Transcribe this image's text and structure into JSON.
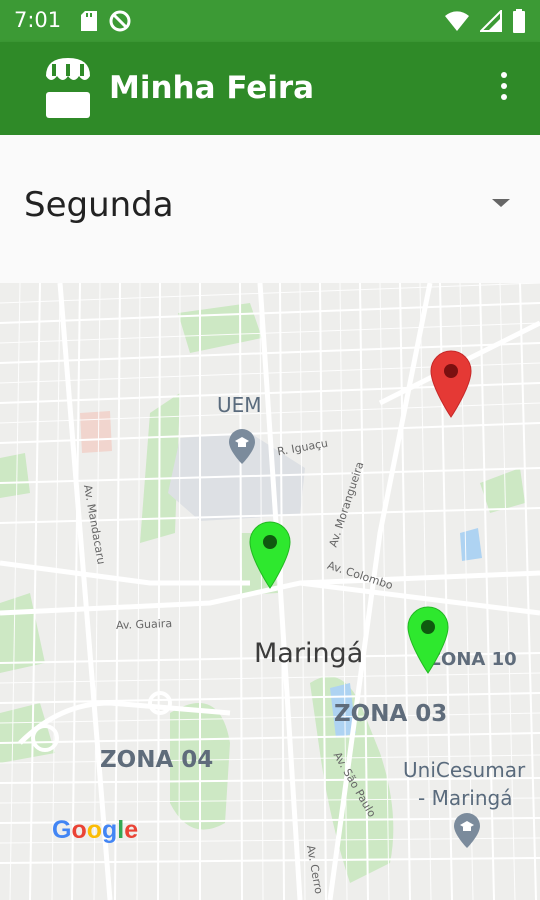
{
  "status_bar": {
    "time": "7:01",
    "icons": [
      "sd-card-icon",
      "no-sync-icon",
      "wifi-icon",
      "signal-icon",
      "battery-icon"
    ]
  },
  "app_bar": {
    "title": "Minha Feira",
    "logo_icon": "market-stall-icon",
    "menu_icon": "overflow-menu-icon",
    "color": "#2f8a28"
  },
  "day_selector": {
    "selected": "Segunda"
  },
  "map": {
    "place_labels": {
      "uem": "UEM",
      "city": "Maringá",
      "zona_10": "ZONA 10",
      "zona_03": "ZONA 03",
      "zona_04": "ZONA 04",
      "unicesumar_line1": "UniCesumar",
      "unicesumar_line2": "- Maringá"
    },
    "street_labels": {
      "r_iguacu": "R. Iguaçu",
      "av_mandacaru": "Av. Mandacaru",
      "av_morangueira": "Av. Morangueira",
      "av_colombo": "Av. Colombo",
      "av_guaira": "Av. Guaira",
      "av_sao_paulo": "Av. São Paulo",
      "av_cerro": "Av. Cerro"
    },
    "markers": [
      {
        "name": "fair-marker-red",
        "color": "#e53935"
      },
      {
        "name": "fair-marker-green-1",
        "color": "#2ee82e"
      },
      {
        "name": "fair-marker-green-2",
        "color": "#2ee82e"
      }
    ],
    "attribution": "Google"
  }
}
